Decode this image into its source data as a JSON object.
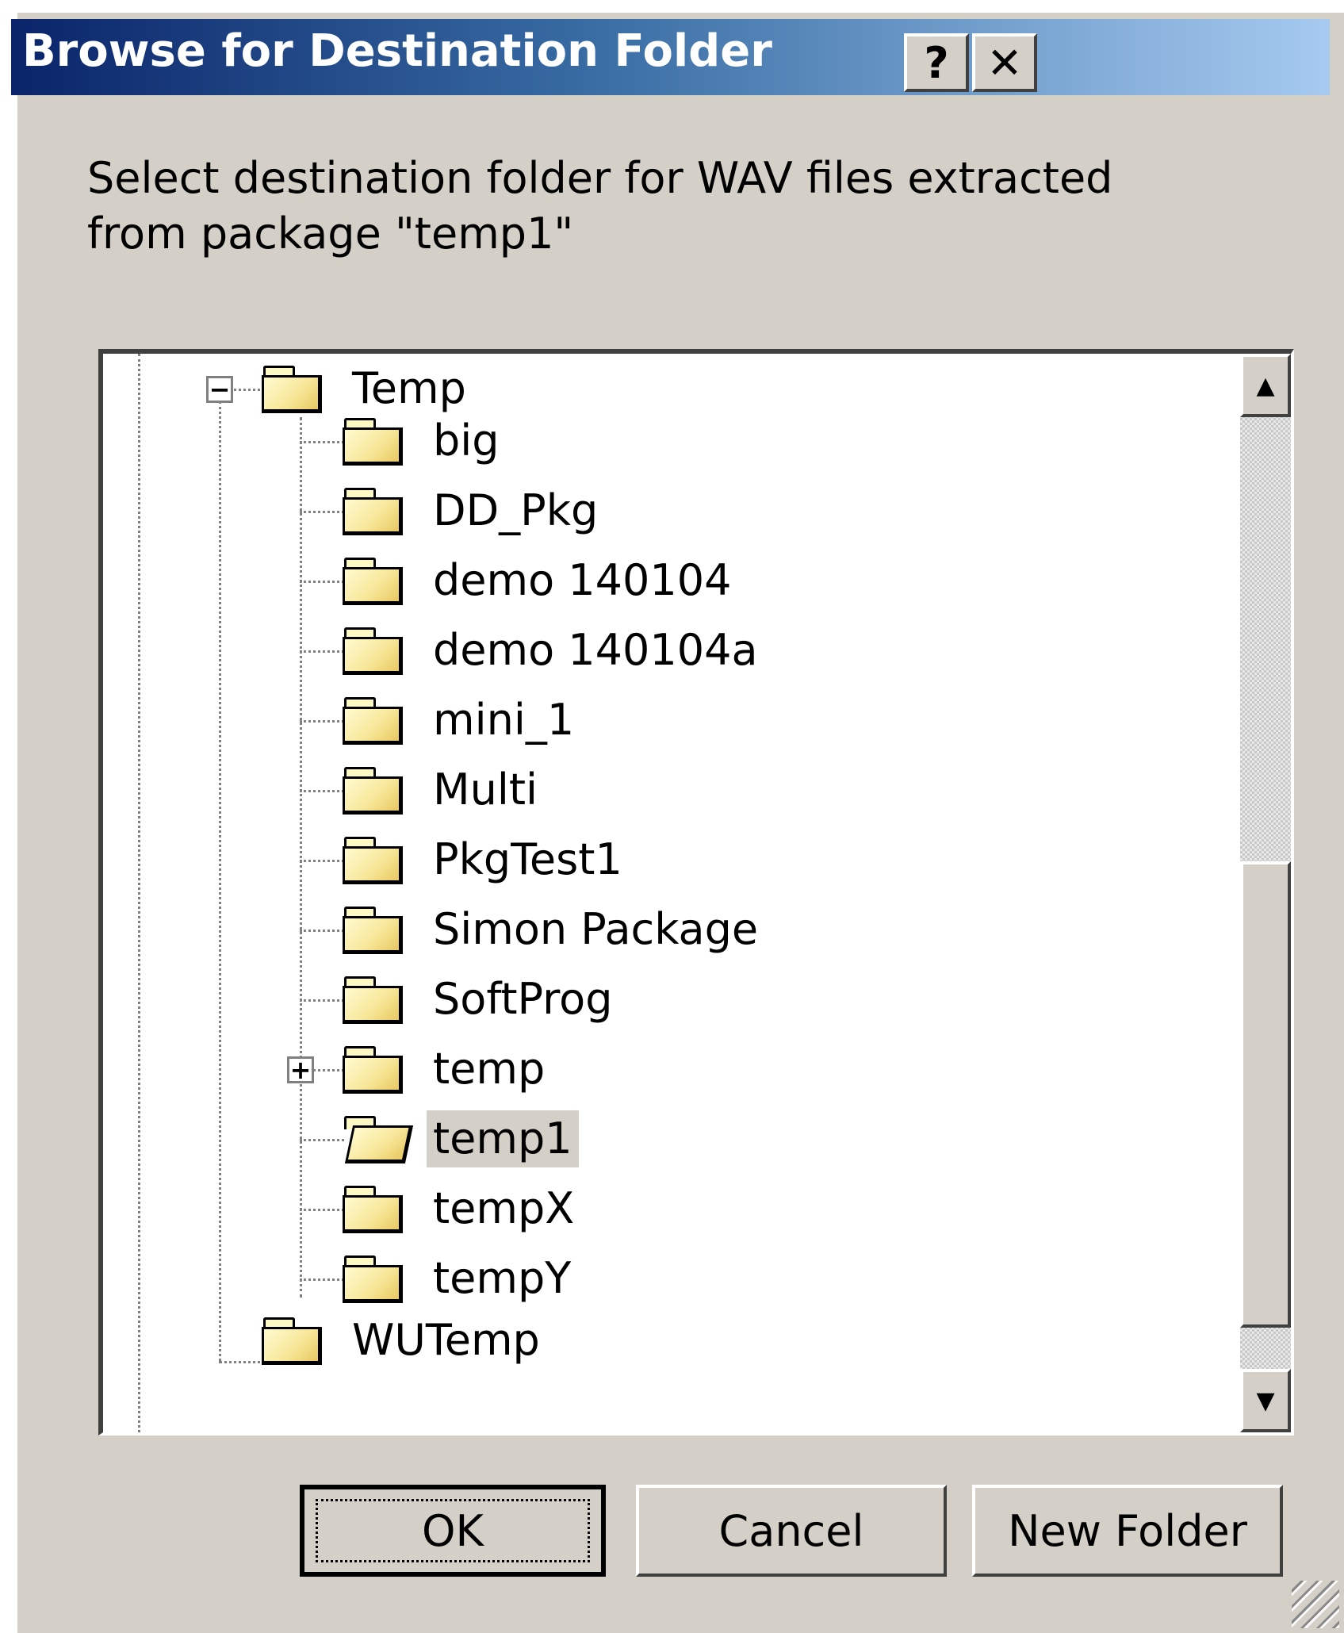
{
  "window": {
    "title": "Browse for Destination Folder",
    "help_label": "?",
    "close_label": "✕"
  },
  "instruction": "Select destination folder for WAV files extracted from package \"temp1\"",
  "tree": {
    "parent": {
      "label": "Temp",
      "expander": "−"
    },
    "children": [
      {
        "label": "big"
      },
      {
        "label": "DD_Pkg"
      },
      {
        "label": "demo 140104"
      },
      {
        "label": "demo 140104a"
      },
      {
        "label": "mini_1"
      },
      {
        "label": "Multi"
      },
      {
        "label": "PkgTest1"
      },
      {
        "label": "Simon Package"
      },
      {
        "label": "SoftProg"
      },
      {
        "label": "temp",
        "expander": "+"
      },
      {
        "label": "temp1",
        "selected": true
      },
      {
        "label": "tempX"
      },
      {
        "label": "tempY"
      }
    ],
    "sibling": {
      "label": "WUTemp"
    },
    "scroll_up": "▲",
    "scroll_down": "▼"
  },
  "buttons": {
    "ok": "OK",
    "cancel": "Cancel",
    "new_folder": "New Folder"
  }
}
